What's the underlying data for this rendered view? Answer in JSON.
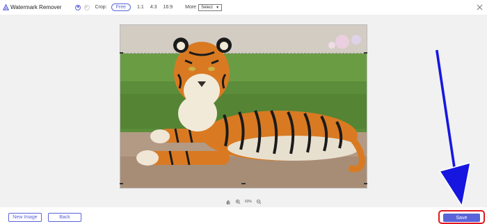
{
  "app": {
    "title": "Watermark Remover",
    "brand_color": "#5a63d8"
  },
  "toolbar": {
    "undo_icon": "undo-icon",
    "redo_icon": "redo-icon",
    "crop_label": "Crop:",
    "crop_options": [
      "Free",
      "1:1",
      "4:3",
      "16:9"
    ],
    "crop_selected": "Free",
    "more_label": "More",
    "more_select_value": "Select"
  },
  "zoom": {
    "level": "60%"
  },
  "footer": {
    "new_image_label": "New Image",
    "back_label": "Back",
    "save_label": "Save"
  },
  "annotation": {
    "highlight_color": "#e0181f",
    "arrow_color": "#1616e0"
  }
}
